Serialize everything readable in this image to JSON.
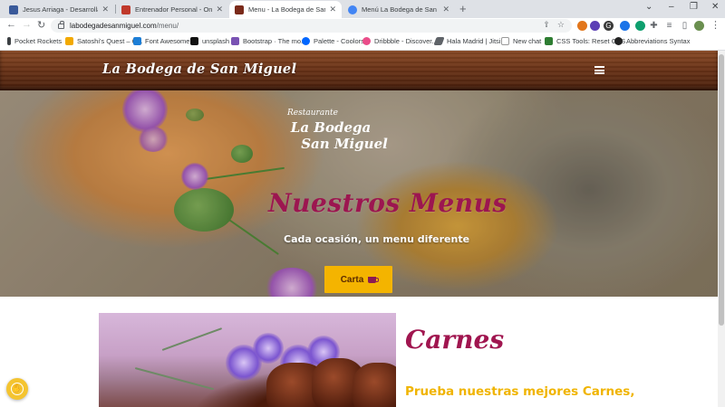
{
  "browser": {
    "tabs": [
      {
        "title": "Jesus Arriaga - Desarrollador Fro",
        "favicon_color": "#3a5a9a",
        "active": false
      },
      {
        "title": "Entrenador Personal - Online - Fi",
        "favicon_color": "#c0392b",
        "active": false
      },
      {
        "title": "Menu - La Bodega de San Miguel",
        "favicon_color": "#7a2a1a",
        "active": true
      },
      {
        "title": "Menú La Bodega de San Miguel",
        "favicon_color": "#4285f4",
        "active": false
      }
    ],
    "new_tab_label": "+",
    "window_controls": [
      "⌄",
      "–",
      "❐",
      "✕"
    ],
    "nav": {
      "back": "←",
      "forward": "→",
      "reload": "↻"
    },
    "url_host": "labodegadesanmiguel.com",
    "url_path": "/menu/",
    "omnibox_icons": [
      "share-icon",
      "bookmark-star-icon"
    ],
    "extensions": [
      {
        "name": "metamask-icon",
        "glyph": "◆",
        "color": "#e2761b"
      },
      {
        "name": "extension-circle-icon",
        "glyph": "◍",
        "color": "#5b3fb5"
      },
      {
        "name": "extension-g-icon",
        "glyph": "G",
        "color": "#3a3a3a"
      },
      {
        "name": "extension-blue-icon",
        "glyph": "◉",
        "color": "#1a73e8"
      },
      {
        "name": "extension-teal-icon",
        "glyph": "●",
        "color": "#0e9f6e"
      },
      {
        "name": "puzzle-icon",
        "glyph": "✚",
        "color": "#5f6368"
      },
      {
        "name": "reading-list-icon",
        "glyph": "≡",
        "color": "#5f6368"
      },
      {
        "name": "sidepanel-icon",
        "glyph": "▯",
        "color": "#5f6368"
      },
      {
        "name": "profile-avatar",
        "glyph": "●",
        "color": "#6a8f4f"
      },
      {
        "name": "menu-dots-icon",
        "glyph": "⋮",
        "color": "#5f6368"
      }
    ],
    "bookmarks": [
      {
        "label": "Pocket Rockets",
        "color": "#3c4043"
      },
      {
        "label": "Satoshi's Quest – C...",
        "color": "#f2a900"
      },
      {
        "label": "Font Awesome",
        "color": "#1c7ed6"
      },
      {
        "label": "unsplash",
        "color": "#111111"
      },
      {
        "label": "Bootstrap · The mo...",
        "color": "#7952b3"
      },
      {
        "label": "Palette - Coolors",
        "color": "#0066ff"
      },
      {
        "label": "Dribbble - Discover...",
        "color": "#ea4c89"
      },
      {
        "label": "Hala Madrid | Jitsi...",
        "color": "#5f6368"
      },
      {
        "label": "New chat",
        "color": "#ffffff"
      },
      {
        "label": "CSS Tools: Reset CSS",
        "color": "#2e7d32"
      },
      {
        "label": "Abbreviations Syntax",
        "color": "#222222"
      }
    ]
  },
  "site": {
    "logo": "La Bodega de San Miguel",
    "emblem": {
      "small": "Restaurante",
      "line1": "La Bodega",
      "line2": "San Miguel"
    },
    "hero_title": "Nuestros Menus",
    "hero_subtitle": "Cada ocasión, un menu diferente",
    "hero_button": "Carta",
    "section_title": "Carnes",
    "section_subtitle": "Prueba nuestras mejores Carnes,",
    "colors": {
      "accent": "#9c1650",
      "button": "#f4b400",
      "subtitle": "#f0b400"
    }
  },
  "accessibility_widget": {
    "glyph": "✋"
  }
}
